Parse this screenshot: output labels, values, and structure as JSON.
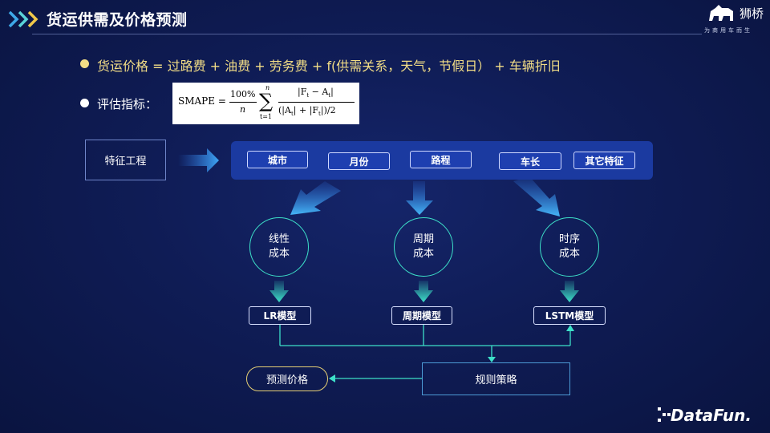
{
  "header": {
    "title": "货运供需及价格预测"
  },
  "logo": {
    "name": "狮桥",
    "tagline": "为商用车而生"
  },
  "bullets": {
    "price_formula": "货运价格 = 过路费 + 油费 + 劳务费 + f(供需关系，天气，节假日） + 车辆折旧",
    "metric_label": "评估指标：",
    "metric_formula": {
      "lhs": "SMAPE =",
      "coef_num": "100%",
      "coef_den": "n",
      "sum_top": "n",
      "sum_bottom": "t=1",
      "frac_num": "|F",
      "frac_num_sub1": "t",
      "frac_num_mid": " − A",
      "frac_num_sub2": "t",
      "frac_den": "(|A",
      "frac_den_sub1": "t",
      "frac_den_mid": "| + |F",
      "frac_den_sub2": "t",
      "frac_den_end": "|)/2"
    }
  },
  "diagram": {
    "feature_engineering": "特征工程",
    "features": [
      "城市",
      "月份",
      "路程",
      "车长",
      "其它特征"
    ],
    "costs": [
      {
        "line1": "线性",
        "line2": "成本"
      },
      {
        "line1": "周期",
        "line2": "成本"
      },
      {
        "line1": "时序",
        "line2": "成本"
      }
    ],
    "models": [
      "LR模型",
      "周期模型",
      "LSTM模型"
    ],
    "rule_strategy": "规则策略",
    "predict_price": "预测价格"
  },
  "footer": {
    "brand": "DataFun."
  },
  "colors": {
    "accent_yellow": "#f2dd86",
    "teal": "#3de0c8",
    "panel_blue": "#1b3aa0",
    "bg": "#0f1c55"
  }
}
